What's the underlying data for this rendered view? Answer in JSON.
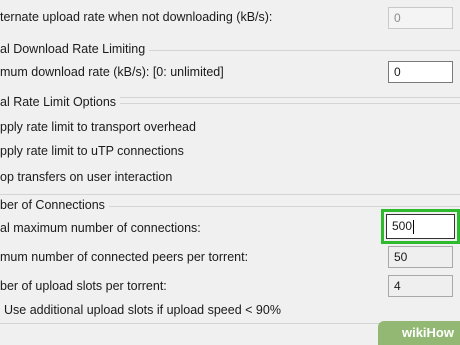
{
  "upload": {
    "alt_rate_label": "ternate upload rate when not downloading (kB/s):",
    "alt_rate_value": "0"
  },
  "download_group": {
    "title": "al Download Rate Limiting",
    "max_rate_label": "mum download rate (kB/s): [0: unlimited]",
    "max_rate_value": "0"
  },
  "rate_limit_group": {
    "title": "al Rate Limit Options",
    "overhead_label": "pply rate limit to transport overhead",
    "utp_label": "pply rate limit to uTP connections",
    "stop_label": "op transfers on user interaction"
  },
  "connections_group": {
    "title": "ber of Connections",
    "max_conn_label": "al maximum number of connections:",
    "max_conn_value": "500",
    "peers_label": "mum number of connected peers per torrent:",
    "peers_value": "50",
    "slots_label": "ber of upload slots per torrent:",
    "slots_value": "4",
    "additional_slots_label": "Use additional upload slots if upload speed < 90%"
  },
  "watermark": {
    "wiki": "wiki",
    "how": "How"
  },
  "colors": {
    "focus_highlight": "#2dbb2d",
    "watermark_bg": "#93b874"
  }
}
